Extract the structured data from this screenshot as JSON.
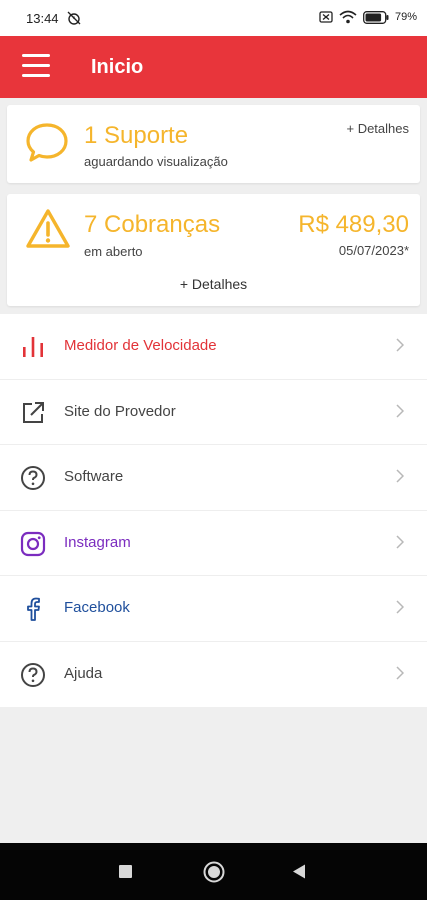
{
  "status_bar": {
    "time": "13:44",
    "battery": "79"
  },
  "header": {
    "title": "Inicio"
  },
  "support_card": {
    "title": "1 Suporte",
    "subtitle": "aguardando visualização",
    "details_link": "+ Detalhes"
  },
  "billing_card": {
    "title": "7 Cobranças",
    "subtitle": "em aberto",
    "amount": "R$ 489,30",
    "date": "05/07/2023*",
    "details_link": "+ Detalhes"
  },
  "menu": [
    {
      "label": "Medidor de Velocidade",
      "icon": "speed-chart-icon",
      "color": "#e23338"
    },
    {
      "label": "Site do Provedor",
      "icon": "external-link-icon",
      "color": "#444444"
    },
    {
      "label": "Software",
      "icon": "help-circle-icon",
      "color": "#444444"
    },
    {
      "label": "Instagram",
      "icon": "instagram-icon",
      "color": "#7b2cbf"
    },
    {
      "label": "Facebook",
      "icon": "facebook-icon",
      "color": "#1f4f9c"
    },
    {
      "label": "Ajuda",
      "icon": "help-circle-icon",
      "color": "#444444"
    }
  ],
  "colors": {
    "primary": "#e8353b",
    "warning": "#f5b52c"
  }
}
